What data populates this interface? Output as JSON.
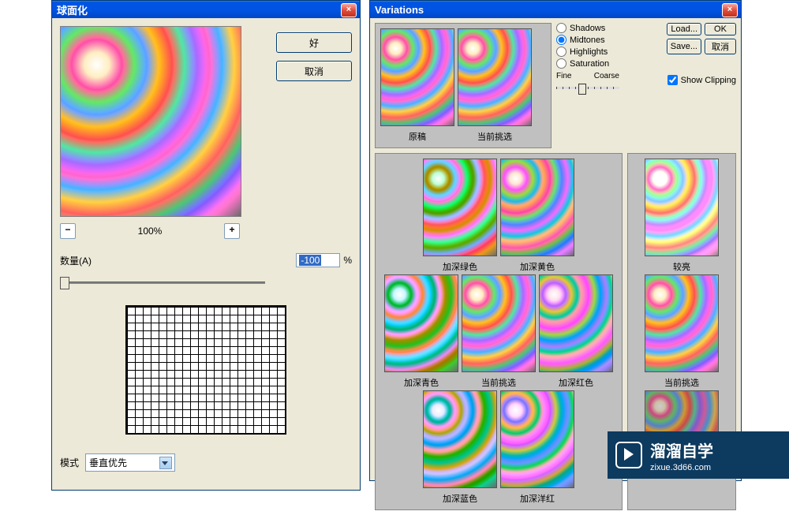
{
  "spherize": {
    "title": "球面化",
    "close": "×",
    "ok": "好",
    "cancel": "取消",
    "zoom": "100%",
    "zoom_out": "−",
    "zoom_in": "+",
    "amount_label": "数量(A)",
    "amount_value": "-100",
    "amount_suffix": "%",
    "mode_label": "模式",
    "mode_value": "垂直优先"
  },
  "variations": {
    "title": "Variations",
    "close": "×",
    "radios": {
      "shadows": "Shadows",
      "midtones": "Midtones",
      "highlights": "Highlights",
      "saturation": "Saturation"
    },
    "selected_radio": "midtones",
    "fine": "Fine",
    "coarse": "Coarse",
    "show_clipping": "Show Clipping",
    "buttons": {
      "load": "Load...",
      "ok": "OK",
      "save": "Save...",
      "cancel": "取消"
    },
    "top_thumbs": {
      "original": "原稿",
      "current": "当前挑选"
    },
    "color_thumbs": {
      "more_green": "加深绿色",
      "more_yellow": "加深黄色",
      "more_cyan": "加深青色",
      "current": "当前挑选",
      "more_red": "加深红色",
      "more_blue": "加深蓝色",
      "more_magenta": "加深洋红"
    },
    "side_thumbs": {
      "lighter": "较亮",
      "current": "当前挑选"
    }
  },
  "watermark": {
    "line1": "溜溜自学",
    "line2": "zixue.3d66.com"
  }
}
